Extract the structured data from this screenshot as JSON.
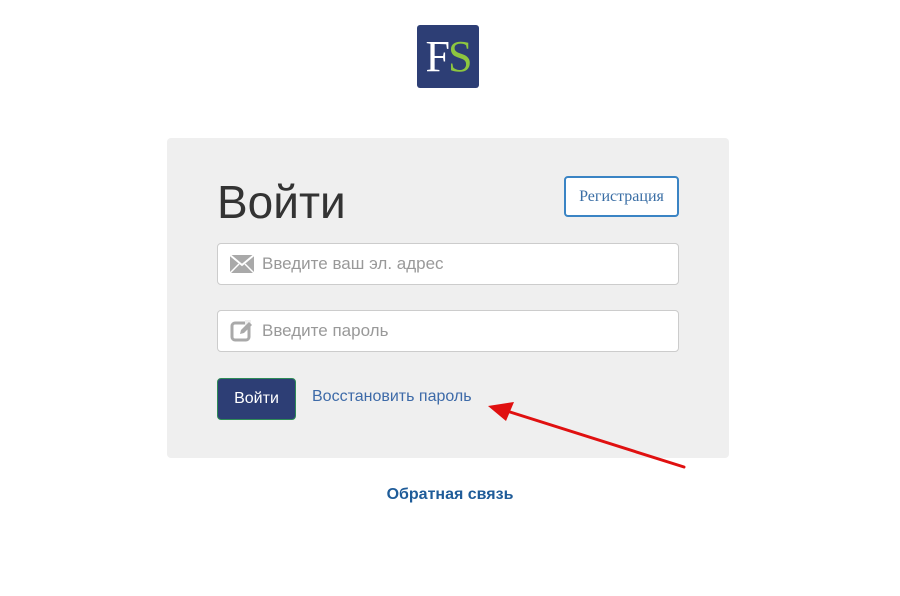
{
  "logo": {
    "letter_f": "F",
    "letter_s": "S",
    "bg_color": "#2d3e75",
    "accent_color": "#8dc63f"
  },
  "login_form": {
    "title": "Войти",
    "register_label": "Регистрация",
    "email": {
      "placeholder": "Введите ваш эл. адрес",
      "value": "",
      "icon": "envelope-icon"
    },
    "password": {
      "placeholder": "Введите пароль",
      "value": "",
      "icon": "edit-icon"
    },
    "submit_label": "Войти",
    "forgot_password_label": "Восстановить пароль"
  },
  "footer": {
    "feedback_label": "Обратная связь"
  },
  "annotation": {
    "arrow_color": "#e01010"
  }
}
